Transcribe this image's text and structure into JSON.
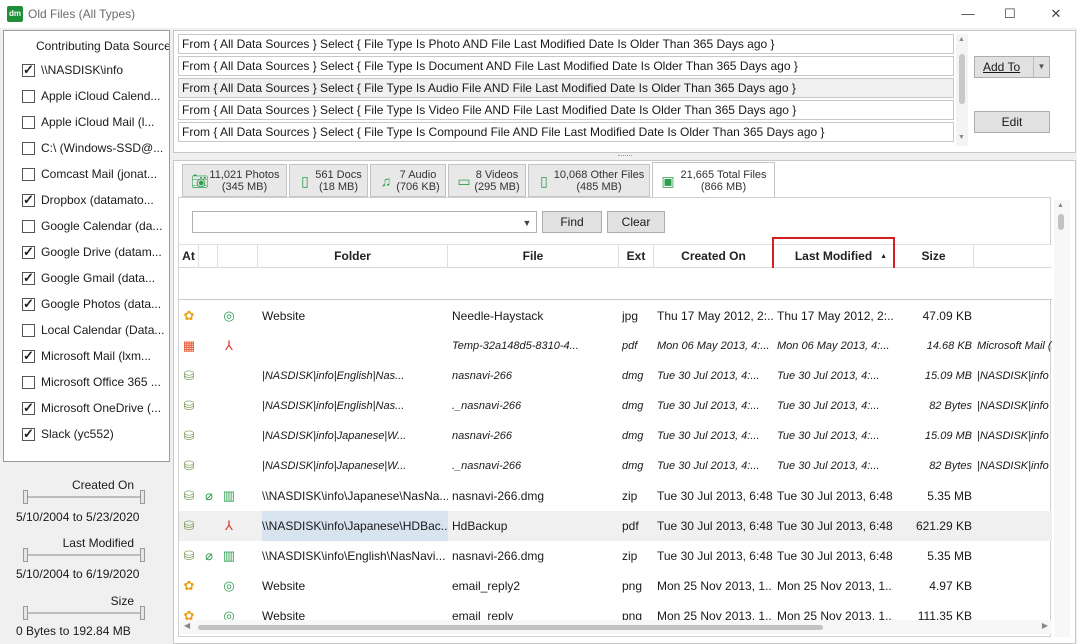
{
  "window": {
    "title": "Old Files (All Types)",
    "app_icon": "dm",
    "minimize": "—",
    "maximize": "☐",
    "close": "✕"
  },
  "sources": {
    "header": "Contributing Data Sources",
    "items": [
      {
        "label": "\\\\NASDISK\\info",
        "checked": true
      },
      {
        "label": "Apple iCloud Calend...",
        "checked": false
      },
      {
        "label": "Apple iCloud Mail (l...",
        "checked": false
      },
      {
        "label": "C:\\ (Windows-SSD@...",
        "checked": false
      },
      {
        "label": "Comcast Mail (jonat...",
        "checked": false
      },
      {
        "label": "Dropbox (datamato...",
        "checked": true
      },
      {
        "label": "Google Calendar (da...",
        "checked": false
      },
      {
        "label": "Google Drive (datam...",
        "checked": true
      },
      {
        "label": "Google Gmail (data...",
        "checked": true
      },
      {
        "label": "Google Photos (data...",
        "checked": true
      },
      {
        "label": "Local Calendar (Data...",
        "checked": false
      },
      {
        "label": "Microsoft Mail (lxm...",
        "checked": true
      },
      {
        "label": "Microsoft Office 365 ...",
        "checked": false
      },
      {
        "label": "Microsoft OneDrive (...",
        "checked": true
      },
      {
        "label": "Slack (yc552)",
        "checked": true
      }
    ]
  },
  "filters": {
    "created_title": "Created On",
    "created_range": "5/10/2004 to 5/23/2020",
    "modified_title": "Last Modified",
    "modified_range": "5/10/2004 to 6/19/2020",
    "size_title": "Size",
    "size_range": "0 Bytes to 192.84 MB"
  },
  "queries": [
    "From { All Data Sources } Select { File Type Is Photo AND File Last Modified Date Is Older Than 365 Days ago }",
    "From { All Data Sources } Select { File Type Is Document AND File Last Modified Date Is Older Than 365 Days ago }",
    "From { All Data Sources } Select { File Type Is Audio File AND File Last Modified Date Is Older Than 365 Days ago }",
    "From { All Data Sources } Select { File Type Is Video File AND File Last Modified Date Is Older Than 365 Days ago }",
    "From { All Data Sources } Select { File Type Is Compound File AND File Last Modified Date Is Older Than 365 Days ago }"
  ],
  "query_buttons": {
    "add_to": "Add To",
    "edit": "Edit"
  },
  "tabs": [
    {
      "line1": "11,021 Photos",
      "line2": "(345 MB)",
      "icon": "camera-icon"
    },
    {
      "line1": "561 Docs",
      "line2": "(18 MB)",
      "icon": "document-icon"
    },
    {
      "line1": "7 Audio",
      "line2": "(706 KB)",
      "icon": "music-icon"
    },
    {
      "line1": "8 Videos",
      "line2": "(295 MB)",
      "icon": "video-icon"
    },
    {
      "line1": "10,068 Other Files",
      "line2": "(485 MB)",
      "icon": "file-icon"
    },
    {
      "line1": "21,665 Total Files",
      "line2": "(866 MB)",
      "icon": "all-files-icon"
    }
  ],
  "search": {
    "find": "Find",
    "clear": "Clear",
    "value": ""
  },
  "columns": {
    "at": "At",
    "folder": "Folder",
    "file": "File",
    "ext": "Ext",
    "created": "Created On",
    "modified": "Last Modified",
    "size": "Size",
    "sort_indicator": "▲"
  },
  "rows": [
    {
      "src": "google-photos",
      "type": "camera",
      "folder": "Website",
      "file": "Needle-Haystack",
      "ext": "jpg",
      "created": "Thu 17 May 2012, 2:...",
      "modified": "Thu 17 May 2012, 2:...",
      "size": "47.09 KB",
      "location": "",
      "italic": false
    },
    {
      "src": "microsoft",
      "type": "pdf",
      "folder": "",
      "file": "Temp-32a148d5-8310-4...",
      "ext": "pdf",
      "created": "Mon 06 May 2013, 4:...",
      "modified": "Mon 06 May 2013, 4:...",
      "size": "14.68 KB",
      "location": "Microsoft Mail (l",
      "italic": true
    },
    {
      "src": "nas",
      "type": "",
      "folder": "|NASDISK|info|English|Nas...",
      "file": "nasnavi-266",
      "ext": "dmg",
      "created": "Tue 30 Jul 2013, 4:...",
      "modified": "Tue 30 Jul 2013, 4:...",
      "size": "15.09 MB",
      "location": "|NASDISK|info",
      "italic": true
    },
    {
      "src": "nas",
      "type": "",
      "folder": "|NASDISK|info|English|Nas...",
      "file": "._nasnavi-266",
      "ext": "dmg",
      "created": "Tue 30 Jul 2013, 4:...",
      "modified": "Tue 30 Jul 2013, 4:...",
      "size": "82 Bytes",
      "location": "|NASDISK|info",
      "italic": true
    },
    {
      "src": "nas",
      "type": "",
      "folder": "|NASDISK|info|Japanese|W...",
      "file": "nasnavi-266",
      "ext": "dmg",
      "created": "Tue 30 Jul 2013, 4:...",
      "modified": "Tue 30 Jul 2013, 4:...",
      "size": "15.09 MB",
      "location": "|NASDISK|info",
      "italic": true
    },
    {
      "src": "nas",
      "type": "",
      "folder": "|NASDISK|info|Japanese|W...",
      "file": "._nasnavi-266",
      "ext": "dmg",
      "created": "Tue 30 Jul 2013, 4:...",
      "modified": "Tue 30 Jul 2013, 4:...",
      "size": "82 Bytes",
      "location": "|NASDISK|info",
      "italic": true
    },
    {
      "src": "nas",
      "type": "zip",
      "folder": "\\\\NASDISK\\info\\Japanese\\NasNa...",
      "file": "nasnavi-266.dmg",
      "ext": "zip",
      "created": "Tue 30 Jul 2013, 6:48...",
      "modified": "Tue 30 Jul 2013, 6:48...",
      "size": "5.35 MB",
      "location": "",
      "italic": false
    },
    {
      "src": "nas",
      "type": "pdf",
      "folder": "\\\\NASDISK\\info\\Japanese\\HDBac...",
      "file": "HdBackup",
      "ext": "pdf",
      "created": "Tue 30 Jul 2013, 6:48...",
      "modified": "Tue 30 Jul 2013, 6:48...",
      "size": "621.29 KB",
      "location": "",
      "italic": false
    },
    {
      "src": "nas",
      "type": "zip",
      "folder": "\\\\NASDISK\\info\\English\\NasNavi...",
      "file": "nasnavi-266.dmg",
      "ext": "zip",
      "created": "Tue 30 Jul 2013, 6:48...",
      "modified": "Tue 30 Jul 2013, 6:48...",
      "size": "5.35 MB",
      "location": "",
      "italic": false
    },
    {
      "src": "google-photos",
      "type": "camera",
      "folder": "Website",
      "file": "email_reply2",
      "ext": "png",
      "created": "Mon 25 Nov 2013, 1...",
      "modified": "Mon 25 Nov 2013, 1...",
      "size": "4.97 KB",
      "location": "",
      "italic": false
    },
    {
      "src": "google-photos",
      "type": "camera",
      "folder": "Website",
      "file": "email_reply",
      "ext": "png",
      "created": "Mon 25 Nov 2013, 1...",
      "modified": "Mon 25 Nov 2013, 1...",
      "size": "111.35 KB",
      "location": "",
      "italic": false
    }
  ],
  "colors": {
    "accent_red": "#d42020",
    "green": "#2e9d4e",
    "pdf_red": "#d9382c"
  }
}
